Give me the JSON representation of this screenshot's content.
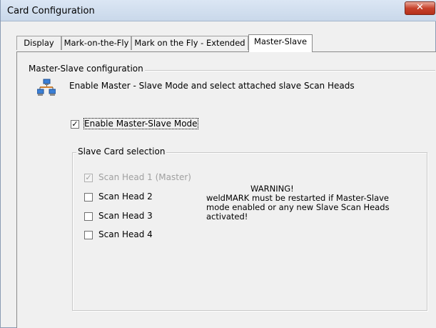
{
  "window": {
    "title": "Card Configuration",
    "close_label": "✕"
  },
  "tabs": [
    {
      "label": "Display"
    },
    {
      "label": "Mark-on-the-Fly"
    },
    {
      "label": "Mark on the Fly - Extended"
    },
    {
      "label": "Master-Slave",
      "active": true
    }
  ],
  "master_slave": {
    "group_title": "Master-Slave configuration",
    "icon": "network-computers-icon",
    "description": "Enable Master - Slave Mode and select attached slave Scan Heads",
    "enable_checkbox": {
      "label": "Enable Master-Slave Mode",
      "checked": true,
      "check_mark": "✓"
    },
    "slave_group_title": "Slave Card selection",
    "scan_heads": [
      {
        "label": "Scan Head 1 (Master)",
        "checked": true,
        "disabled": true,
        "check_mark": "✓"
      },
      {
        "label": "Scan Head 2",
        "checked": false,
        "disabled": false,
        "check_mark": ""
      },
      {
        "label": "Scan Head 3",
        "checked": false,
        "disabled": false,
        "check_mark": ""
      },
      {
        "label": "Scan Head 4",
        "checked": false,
        "disabled": false,
        "check_mark": ""
      }
    ],
    "warning": {
      "title": "WARNING!",
      "line1": "weldMARK must be restarted if Master-Slave",
      "line2": "mode enabled or any new Slave Scan Heads",
      "line3": "activated!"
    }
  }
}
